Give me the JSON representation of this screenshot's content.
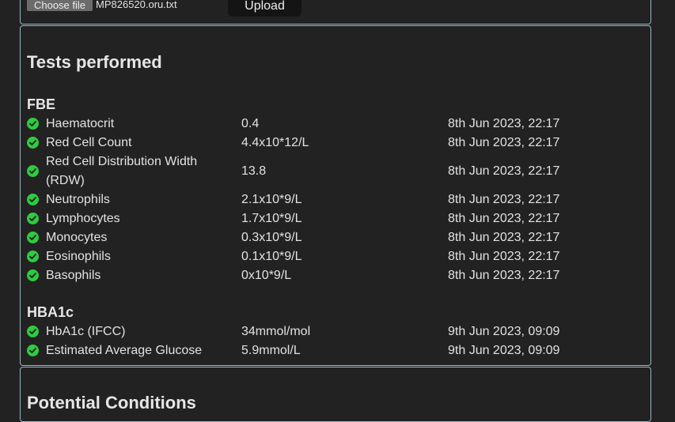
{
  "upload": {
    "choose_file_label": "Choose file",
    "file_name": "MP826520.oru.txt",
    "upload_label": "Upload"
  },
  "tests": {
    "title": "Tests performed",
    "groups": [
      {
        "name": "FBE",
        "rows": [
          {
            "name": "Haematocrit",
            "value": "0.4",
            "date": "8th Jun 2023, 22:17"
          },
          {
            "name": "Red Cell Count",
            "value": "4.4x10*12/L",
            "date": "8th Jun 2023, 22:17"
          },
          {
            "name": "Red Cell Distribution Width (RDW)",
            "value": "13.8",
            "date": "8th Jun 2023, 22:17"
          },
          {
            "name": "Neutrophils",
            "value": "2.1x10*9/L",
            "date": "8th Jun 2023, 22:17"
          },
          {
            "name": "Lymphocytes",
            "value": "1.7x10*9/L",
            "date": "8th Jun 2023, 22:17"
          },
          {
            "name": "Monocytes",
            "value": "0.3x10*9/L",
            "date": "8th Jun 2023, 22:17"
          },
          {
            "name": "Eosinophils",
            "value": "0.1x10*9/L",
            "date": "8th Jun 2023, 22:17"
          },
          {
            "name": "Basophils",
            "value": "0x10*9/L",
            "date": "8th Jun 2023, 22:17"
          }
        ]
      },
      {
        "name": "HBA1c",
        "rows": [
          {
            "name": "HbA1c (IFCC)",
            "value": "34mmol/mol",
            "date": "9th Jun 2023, 09:09"
          },
          {
            "name": "Estimated Average Glucose",
            "value": "5.9mmol/L",
            "date": "9th Jun 2023, 09:09"
          }
        ]
      }
    ]
  },
  "conditions": {
    "title": "Potential Conditions"
  },
  "colors": {
    "check": "#2ecc40",
    "card_border": "#9bb4c0",
    "background": "#222222"
  },
  "icons": {
    "status": "check-circle-icon"
  }
}
